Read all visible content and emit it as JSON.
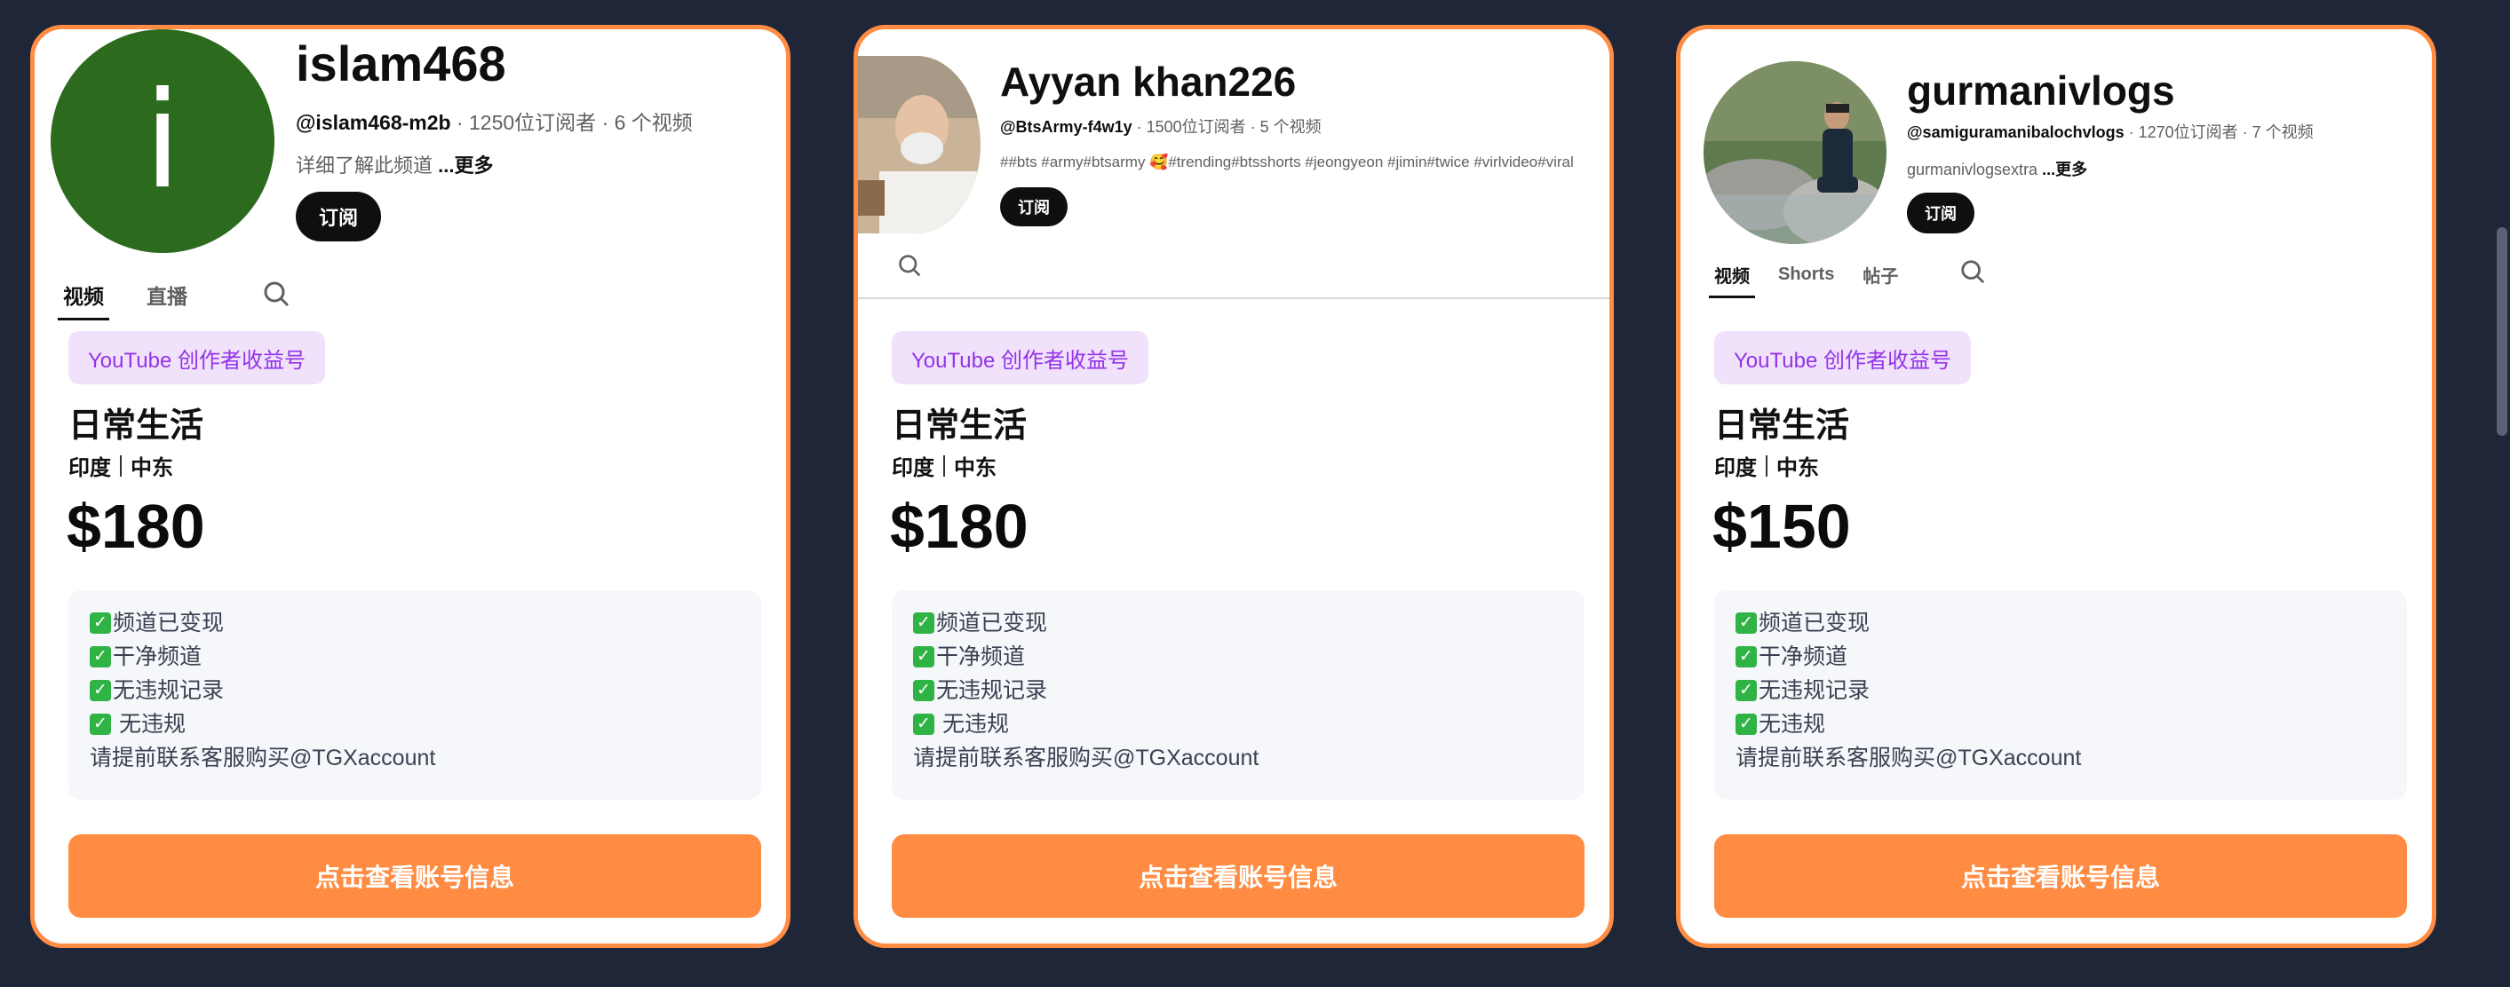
{
  "cards": [
    {
      "channel_name": "islam468",
      "handle": "@islam468-m2b",
      "meta": " · 1250位订阅者 · 6 个视频",
      "description": "详细了解此频道 ",
      "more": "...更多",
      "avatar_letter": "i",
      "subscribe": "订阅",
      "tabs": [
        "视频",
        "直播"
      ],
      "badge": "YouTube 创作者收益号",
      "category": "日常生活",
      "regions": [
        "印度",
        "中东"
      ],
      "price": "$180",
      "features": [
        "频道已变现",
        "干净频道",
        "无违规记录",
        " 无违规"
      ],
      "contact": "请提前联系客服购买@TGXaccount",
      "cta": "点击查看账号信息"
    },
    {
      "channel_name": "Ayyan khan226",
      "handle": "@BtsArmy-f4w1y",
      "meta": " · 1500位订阅者 · 5 个视频",
      "description": "##bts #army#btsarmy 🥰#trending#btsshorts #jeongyeon #jimin#twice  #virlvideo#viral",
      "subscribe": "订阅",
      "badge": "YouTube 创作者收益号",
      "category": "日常生活",
      "regions": [
        "印度",
        "中东"
      ],
      "price": "$180",
      "features": [
        "频道已变现",
        "干净频道",
        "无违规记录",
        " 无违规"
      ],
      "contact": "请提前联系客服购买@TGXaccount",
      "cta": "点击查看账号信息"
    },
    {
      "channel_name": "gurmanivlogs",
      "handle": "@samiguramanibalochvlogs",
      "meta": " · 1270位订阅者 · 7 个视频",
      "description": "gurmanivlogsextra ",
      "more": "...更多",
      "subscribe": "订阅",
      "tabs": [
        "视频",
        "Shorts",
        "帖子"
      ],
      "badge": "YouTube 创作者收益号",
      "category": "日常生活",
      "regions": [
        "印度",
        "中东"
      ],
      "price": "$150",
      "features": [
        "频道已变现",
        "干净频道",
        "无违规记录",
        "无违规"
      ],
      "contact": "请提前联系客服购买@TGXaccount",
      "cta": "点击查看账号信息"
    }
  ],
  "colors": {
    "background": "#1e2638",
    "card_border": "#ff8c42",
    "cta": "#ff8c42",
    "badge_bg": "#f1e2fb",
    "badge_text": "#9333ea",
    "avatar_green": "#2c6b1d"
  }
}
